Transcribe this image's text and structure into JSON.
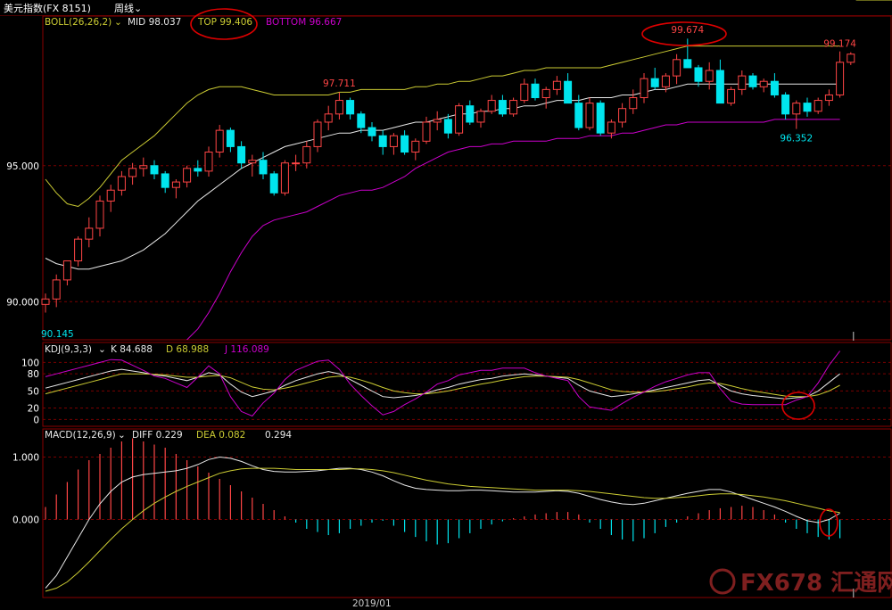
{
  "header": {
    "instrument": "美元指数(FX 8151)",
    "period": "周线",
    "period_menu_icon": "chevron-down-icon"
  },
  "watermark": {
    "text": "FX678 汇通网",
    "color": "#7f1f1f"
  },
  "colors": {
    "up_candle": "#ff4545",
    "down_candle": "#00e5ee",
    "mid_line": "#e8e8e8",
    "top_line": "#cccc33",
    "bottom_line": "#cc00cc",
    "grid": "#7a0000",
    "annotation": "#dd0000"
  },
  "chart_data": [
    {
      "type": "candlestick",
      "indicator": "BOLL(26,26,2)",
      "legend": {
        "name": "BOLL(26,26,2)",
        "mid_label": "MID 98.037",
        "top_label": "TOP 99.406",
        "bottom_label": "BOTTOM 96.667"
      },
      "yticks": [
        "95.000",
        "90.000"
      ],
      "ytick_values": [
        95,
        90
      ],
      "ylim": [
        88.6,
        100.5
      ],
      "xlabel_date": "2019/01",
      "date_label_index": 30,
      "annotations": [
        {
          "text": "97.711",
          "index": 27,
          "value": 97.711,
          "position": "above"
        },
        {
          "text": "99.674",
          "index": 59,
          "value": 99.674,
          "position": "above",
          "circled": true
        },
        {
          "text": "99.174",
          "index": 73,
          "value": 99.174,
          "position": "above"
        },
        {
          "text": "96.352",
          "index": 69,
          "value": 96.352,
          "position": "below"
        }
      ],
      "left_edge_label": "90.145",
      "ohlc": [
        [
          89.9,
          90.3,
          89.6,
          90.1
        ],
        [
          90.1,
          91.0,
          89.8,
          90.8
        ],
        [
          90.8,
          91.4,
          90.6,
          91.5
        ],
        [
          91.5,
          92.4,
          91.3,
          92.3
        ],
        [
          92.3,
          93.1,
          92.0,
          92.7
        ],
        [
          92.7,
          93.9,
          92.4,
          93.7
        ],
        [
          93.7,
          94.3,
          93.3,
          94.1
        ],
        [
          94.1,
          94.8,
          93.9,
          94.6
        ],
        [
          94.6,
          95.1,
          94.3,
          94.9
        ],
        [
          94.9,
          95.3,
          94.6,
          95.0
        ],
        [
          95.0,
          95.2,
          94.5,
          94.7
        ],
        [
          94.7,
          94.8,
          94.0,
          94.2
        ],
        [
          94.2,
          94.5,
          93.8,
          94.4
        ],
        [
          94.4,
          95.0,
          94.2,
          94.9
        ],
        [
          94.9,
          95.2,
          94.6,
          94.8
        ],
        [
          94.8,
          95.7,
          94.6,
          95.5
        ],
        [
          95.5,
          96.5,
          95.3,
          96.3
        ],
        [
          96.3,
          96.4,
          95.5,
          95.7
        ],
        [
          95.7,
          95.9,
          94.9,
          95.1
        ],
        [
          95.1,
          95.4,
          94.6,
          95.2
        ],
        [
          95.2,
          95.5,
          94.5,
          94.7
        ],
        [
          94.7,
          94.8,
          93.9,
          94.0
        ],
        [
          94.0,
          95.2,
          93.9,
          95.1
        ],
        [
          95.1,
          95.4,
          94.8,
          95.1
        ],
        [
          95.1,
          95.9,
          94.9,
          95.7
        ],
        [
          95.7,
          96.7,
          95.5,
          96.6
        ],
        [
          96.6,
          97.2,
          96.3,
          96.9
        ],
        [
          96.9,
          97.7,
          96.7,
          97.4
        ],
        [
          97.4,
          97.5,
          96.7,
          96.9
        ],
        [
          96.9,
          97.0,
          96.2,
          96.4
        ],
        [
          96.4,
          96.6,
          95.9,
          96.1
        ],
        [
          96.1,
          96.3,
          95.4,
          95.7
        ],
        [
          95.7,
          96.2,
          95.4,
          96.1
        ],
        [
          96.1,
          96.3,
          95.4,
          95.5
        ],
        [
          95.5,
          96.0,
          95.2,
          95.9
        ],
        [
          95.9,
          96.8,
          95.8,
          96.6
        ],
        [
          96.6,
          97.0,
          96.3,
          96.7
        ],
        [
          96.7,
          96.9,
          96.0,
          96.2
        ],
        [
          96.2,
          97.3,
          96.1,
          97.2
        ],
        [
          97.2,
          97.4,
          96.5,
          96.6
        ],
        [
          96.6,
          97.1,
          96.4,
          97.0
        ],
        [
          97.0,
          97.6,
          96.9,
          97.4
        ],
        [
          97.4,
          97.6,
          96.8,
          96.9
        ],
        [
          96.9,
          97.5,
          96.8,
          97.4
        ],
        [
          97.4,
          98.2,
          97.3,
          98.0
        ],
        [
          98.0,
          98.2,
          97.4,
          97.5
        ],
        [
          97.5,
          97.9,
          97.1,
          97.8
        ],
        [
          97.8,
          98.3,
          97.6,
          98.1
        ],
        [
          98.1,
          98.4,
          97.3,
          97.3
        ],
        [
          97.3,
          97.6,
          96.3,
          96.4
        ],
        [
          96.4,
          97.5,
          96.3,
          97.3
        ],
        [
          97.3,
          97.4,
          96.1,
          96.2
        ],
        [
          96.2,
          96.7,
          96.0,
          96.6
        ],
        [
          96.6,
          97.3,
          96.4,
          97.1
        ],
        [
          97.1,
          97.8,
          96.9,
          97.5
        ],
        [
          97.5,
          98.4,
          97.3,
          98.2
        ],
        [
          98.2,
          98.6,
          97.8,
          97.9
        ],
        [
          97.9,
          98.4,
          97.7,
          98.3
        ],
        [
          98.3,
          99.1,
          98.0,
          98.9
        ],
        [
          98.9,
          99.67,
          98.6,
          98.6
        ],
        [
          98.6,
          98.7,
          97.9,
          98.1
        ],
        [
          98.1,
          98.8,
          97.8,
          98.5
        ],
        [
          98.5,
          98.9,
          97.4,
          97.3
        ],
        [
          97.3,
          97.9,
          97.2,
          97.8
        ],
        [
          97.8,
          98.5,
          97.6,
          98.3
        ],
        [
          98.3,
          98.4,
          97.8,
          97.9
        ],
        [
          97.9,
          98.2,
          97.7,
          98.1
        ],
        [
          98.1,
          98.4,
          97.5,
          97.6
        ],
        [
          97.6,
          97.7,
          96.7,
          96.9
        ],
        [
          96.9,
          97.4,
          96.35,
          97.3
        ],
        [
          97.3,
          97.5,
          96.8,
          97.0
        ],
        [
          97.0,
          97.5,
          96.9,
          97.4
        ],
        [
          97.4,
          97.8,
          97.2,
          97.6
        ],
        [
          97.6,
          99.2,
          97.5,
          98.8
        ],
        [
          98.8,
          99.17,
          98.7,
          99.1
        ]
      ],
      "mid": [
        91.6,
        91.4,
        91.3,
        91.2,
        91.2,
        91.3,
        91.4,
        91.5,
        91.7,
        91.9,
        92.2,
        92.5,
        92.9,
        93.3,
        93.7,
        94.0,
        94.3,
        94.6,
        94.9,
        95.1,
        95.3,
        95.5,
        95.7,
        95.8,
        95.9,
        96.0,
        96.1,
        96.2,
        96.2,
        96.3,
        96.3,
        96.3,
        96.4,
        96.5,
        96.6,
        96.6,
        96.7,
        96.8,
        96.9,
        96.9,
        97.0,
        97.0,
        97.1,
        97.1,
        97.2,
        97.2,
        97.3,
        97.4,
        97.4,
        97.4,
        97.5,
        97.5,
        97.5,
        97.6,
        97.6,
        97.7,
        97.8,
        97.8,
        97.9,
        98.0,
        98.0,
        98.0,
        98.0,
        98.0,
        98.0,
        98.0,
        98.0,
        98.0,
        98.0,
        98.0,
        98.0,
        98.0,
        98.0,
        98.0
      ],
      "top": [
        94.5,
        94.0,
        93.6,
        93.5,
        93.8,
        94.2,
        94.7,
        95.2,
        95.5,
        95.8,
        96.1,
        96.5,
        96.9,
        97.3,
        97.6,
        97.8,
        97.9,
        97.9,
        97.9,
        97.8,
        97.7,
        97.6,
        97.6,
        97.6,
        97.6,
        97.6,
        97.6,
        97.7,
        97.7,
        97.8,
        97.8,
        97.8,
        97.8,
        97.8,
        97.9,
        97.9,
        98.0,
        98.0,
        98.1,
        98.1,
        98.2,
        98.3,
        98.3,
        98.4,
        98.5,
        98.5,
        98.6,
        98.6,
        98.6,
        98.6,
        98.6,
        98.6,
        98.7,
        98.8,
        98.9,
        99.0,
        99.1,
        99.2,
        99.3,
        99.4,
        99.4,
        99.4,
        99.4,
        99.4,
        99.4,
        99.4,
        99.4,
        99.4,
        99.4,
        99.4,
        99.4,
        99.4,
        99.4,
        99.4
      ],
      "bottom": [
        81.0,
        82.2,
        83.5,
        84.8,
        85.8,
        86.3,
        86.6,
        86.7,
        86.9,
        87.0,
        87.3,
        87.7,
        88.2,
        88.6,
        89.0,
        89.6,
        90.3,
        91.1,
        91.8,
        92.4,
        92.8,
        93.0,
        93.1,
        93.2,
        93.3,
        93.5,
        93.7,
        93.9,
        94.0,
        94.1,
        94.1,
        94.2,
        94.4,
        94.6,
        94.9,
        95.1,
        95.3,
        95.5,
        95.6,
        95.7,
        95.7,
        95.8,
        95.8,
        95.9,
        95.9,
        95.9,
        95.9,
        96.0,
        96.0,
        96.0,
        96.1,
        96.1,
        96.1,
        96.2,
        96.2,
        96.3,
        96.4,
        96.5,
        96.5,
        96.6,
        96.6,
        96.6,
        96.6,
        96.6,
        96.6,
        96.6,
        96.6,
        96.7,
        96.7,
        96.7,
        96.7,
        96.7,
        96.7,
        96.7
      ]
    },
    {
      "type": "line",
      "indicator": "KDJ(9,3,3)",
      "legend": {
        "name": "KDJ(9,3,3)",
        "k_label": "K 84.688",
        "d_label": "D 68.988",
        "j_label": "J 116.089"
      },
      "yticks": [
        "100",
        "80",
        "50",
        "20",
        "0"
      ],
      "ytick_values": [
        100,
        80,
        50,
        20,
        0
      ],
      "ylim": [
        -12,
        135
      ],
      "series": [
        {
          "name": "K",
          "color": "#e8e8e8",
          "values": [
            55,
            60,
            65,
            70,
            75,
            80,
            85,
            88,
            85,
            82,
            78,
            76,
            72,
            68,
            74,
            82,
            78,
            62,
            48,
            40,
            45,
            50,
            60,
            68,
            74,
            80,
            84,
            80,
            70,
            60,
            50,
            40,
            38,
            40,
            42,
            46,
            52,
            56,
            62,
            66,
            70,
            72,
            76,
            78,
            80,
            78,
            76,
            74,
            72,
            60,
            50,
            45,
            40,
            42,
            45,
            48,
            52,
            56,
            60,
            64,
            68,
            70,
            60,
            50,
            45,
            42,
            40,
            38,
            36,
            38,
            40,
            50,
            65,
            80
          ]
        },
        {
          "name": "D",
          "color": "#cccc33",
          "values": [
            45,
            50,
            55,
            60,
            65,
            70,
            75,
            80,
            80,
            80,
            79,
            78,
            76,
            74,
            74,
            76,
            77,
            73,
            65,
            57,
            53,
            52,
            55,
            59,
            64,
            69,
            74,
            76,
            74,
            69,
            63,
            56,
            50,
            47,
            45,
            45,
            47,
            50,
            54,
            58,
            62,
            65,
            69,
            72,
            75,
            76,
            76,
            75,
            74,
            70,
            64,
            58,
            52,
            49,
            48,
            48,
            49,
            51,
            54,
            57,
            61,
            64,
            63,
            59,
            54,
            50,
            47,
            44,
            41,
            40,
            40,
            43,
            50,
            60
          ]
        },
        {
          "name": "J",
          "color": "#cc00cc",
          "values": [
            75,
            80,
            85,
            90,
            95,
            100,
            105,
            104,
            95,
            86,
            76,
            72,
            64,
            56,
            74,
            94,
            80,
            40,
            14,
            6,
            29,
            46,
            70,
            86,
            94,
            102,
            104,
            88,
            62,
            42,
            24,
            8,
            14,
            26,
            36,
            48,
            62,
            68,
            78,
            82,
            86,
            86,
            90,
            90,
            90,
            82,
            76,
            72,
            68,
            40,
            22,
            19,
            16,
            28,
            39,
            48,
            58,
            66,
            72,
            78,
            82,
            82,
            54,
            32,
            27,
            26,
            26,
            26,
            26,
            34,
            40,
            64,
            95,
            120
          ]
        }
      ]
    },
    {
      "type": "bar",
      "indicator": "MACD(12,26,9)",
      "legend": {
        "name": "MACD(12,26,9)",
        "diff_label": "DIFF 0.229",
        "dea_label": "DEA 0.082",
        "macd_label": "0.294"
      },
      "yticks": [
        "1.000",
        "0.000"
      ],
      "ytick_values": [
        1,
        0
      ],
      "ylim": [
        -1.25,
        1.45
      ],
      "histogram": [
        0.2,
        0.4,
        0.6,
        0.8,
        0.95,
        1.05,
        1.15,
        1.25,
        1.3,
        1.25,
        1.2,
        1.15,
        1.05,
        0.95,
        0.85,
        0.75,
        0.65,
        0.55,
        0.45,
        0.35,
        0.25,
        0.15,
        0.05,
        -0.05,
        -0.15,
        -0.2,
        -0.25,
        -0.22,
        -0.15,
        -0.1,
        -0.05,
        -0.02,
        -0.1,
        -0.2,
        -0.28,
        -0.35,
        -0.4,
        -0.38,
        -0.3,
        -0.22,
        -0.15,
        -0.08,
        -0.03,
        0.02,
        0.05,
        0.08,
        0.1,
        0.12,
        0.12,
        0.08,
        -0.05,
        -0.15,
        -0.25,
        -0.32,
        -0.35,
        -0.3,
        -0.22,
        -0.12,
        -0.05,
        0.05,
        0.1,
        0.15,
        0.18,
        0.2,
        0.22,
        0.2,
        0.15,
        0.08,
        -0.05,
        -0.15,
        -0.22,
        -0.28,
        -0.32,
        -0.3
      ],
      "series": [
        {
          "name": "DIFF",
          "color": "#e8e8e8",
          "values": [
            -1.1,
            -0.9,
            -0.6,
            -0.3,
            0,
            0.25,
            0.45,
            0.6,
            0.68,
            0.72,
            0.74,
            0.76,
            0.78,
            0.82,
            0.88,
            0.96,
            1.0,
            0.98,
            0.93,
            0.86,
            0.8,
            0.77,
            0.76,
            0.76,
            0.77,
            0.78,
            0.8,
            0.82,
            0.82,
            0.8,
            0.76,
            0.7,
            0.62,
            0.55,
            0.5,
            0.48,
            0.47,
            0.46,
            0.46,
            0.47,
            0.47,
            0.46,
            0.45,
            0.44,
            0.44,
            0.44,
            0.45,
            0.46,
            0.45,
            0.42,
            0.37,
            0.32,
            0.28,
            0.25,
            0.24,
            0.26,
            0.3,
            0.34,
            0.38,
            0.42,
            0.45,
            0.48,
            0.48,
            0.44,
            0.38,
            0.32,
            0.26,
            0.2,
            0.13,
            0.05,
            -0.02,
            -0.05,
            0.0,
            0.1
          ]
        },
        {
          "name": "DEA",
          "color": "#cccc33",
          "values": [
            -1.15,
            -1.1,
            -1.0,
            -0.85,
            -0.68,
            -0.5,
            -0.32,
            -0.15,
            0.0,
            0.14,
            0.26,
            0.36,
            0.45,
            0.53,
            0.6,
            0.67,
            0.74,
            0.78,
            0.81,
            0.82,
            0.82,
            0.82,
            0.81,
            0.8,
            0.8,
            0.8,
            0.8,
            0.8,
            0.81,
            0.81,
            0.8,
            0.78,
            0.75,
            0.71,
            0.67,
            0.63,
            0.6,
            0.57,
            0.55,
            0.53,
            0.52,
            0.51,
            0.5,
            0.49,
            0.48,
            0.47,
            0.47,
            0.47,
            0.47,
            0.46,
            0.45,
            0.43,
            0.41,
            0.39,
            0.37,
            0.35,
            0.34,
            0.34,
            0.35,
            0.36,
            0.38,
            0.4,
            0.41,
            0.41,
            0.4,
            0.38,
            0.36,
            0.33,
            0.3,
            0.26,
            0.22,
            0.18,
            0.14,
            0.11
          ]
        }
      ]
    }
  ]
}
